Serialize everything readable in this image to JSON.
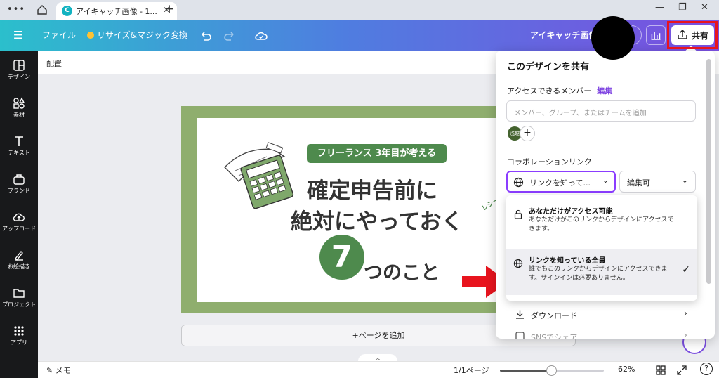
{
  "browser": {
    "tab_title": "アイキャッチ画像 - 1...",
    "tab_favicon": "C",
    "new_tab": "+",
    "menu_dots": "•••",
    "close_tab": "✕"
  },
  "header": {
    "menu_icon": "☰",
    "file_label": "ファイル",
    "resize_label": "リサイズ&マジック変換",
    "doc_title": "アイキャッチ画像",
    "share_label": "共有"
  },
  "sidebar": {
    "items": [
      {
        "label": "デザイン",
        "icon": "design-icon"
      },
      {
        "label": "素材",
        "icon": "elements-icon"
      },
      {
        "label": "テキスト",
        "icon": "text-icon"
      },
      {
        "label": "ブランド",
        "icon": "brand-icon"
      },
      {
        "label": "アップロード",
        "icon": "upload-icon"
      },
      {
        "label": "お絵描き",
        "icon": "draw-icon"
      },
      {
        "label": "プロジェクト",
        "icon": "folder-icon"
      },
      {
        "label": "アプリ",
        "icon": "apps-icon"
      }
    ]
  },
  "context_bar": {
    "position_label": "配置"
  },
  "design": {
    "tag": "フリーランス 3年目が考える",
    "line1": "確定申告前に",
    "line2": "絶対にやっておく",
    "number": "7",
    "line3": "つのこと",
    "sticker": "レシート"
  },
  "canvas": {
    "add_page": "+ページを追加",
    "pages_toggle": "︿"
  },
  "footer": {
    "notes_label": "メモ",
    "page_count": "1/1ページ",
    "zoom": "62%",
    "zoom_level": 0.62,
    "help": "?"
  },
  "share_panel": {
    "title": "このデザインを共有",
    "members_label": "アクセスできるメンバー",
    "edit_link": "編集",
    "input_placeholder": "メンバー、グループ、またはチームを追加",
    "avatar_text": "浅越",
    "collab_label": "コラボレーションリンク",
    "access_select": "リンクを知って...",
    "permission_select": "編集可",
    "options": [
      {
        "title": "あなただけがアクセス可能",
        "desc": "あなただけがこのリンクからデザインにアクセスできます。",
        "selected": false
      },
      {
        "title": "リンクを知っている全員",
        "desc": "誰でもこのリンクからデザインにアクセスできます。サインインは必要ありません。",
        "selected": true
      }
    ],
    "download_label": "ダウンロード",
    "sns_label": "SNSでシェア"
  },
  "colors": {
    "accent_purple": "#8b3dff",
    "highlight_red": "#e8141e",
    "design_green": "#4e8a4d"
  }
}
